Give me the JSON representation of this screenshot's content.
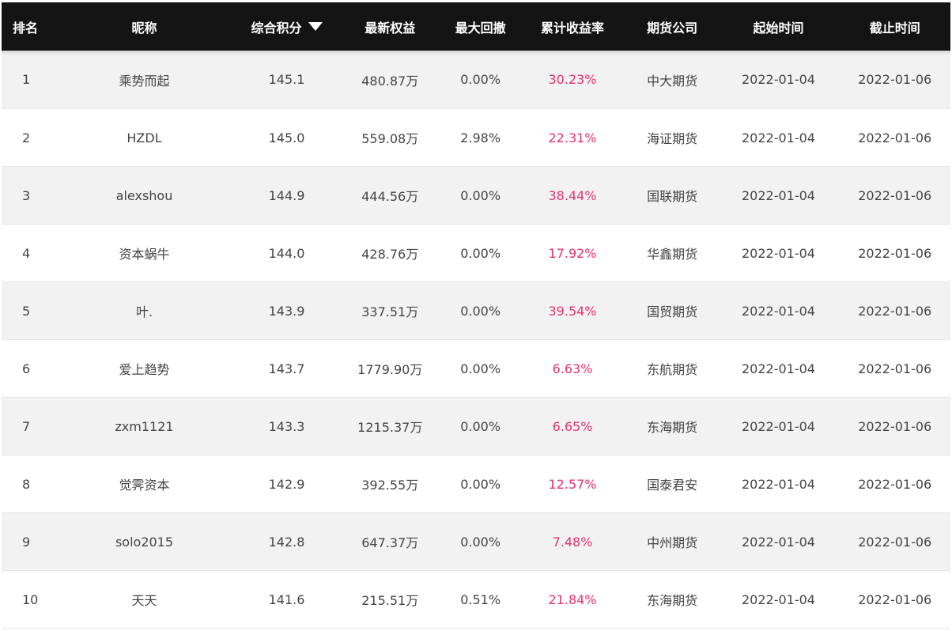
{
  "headers": {
    "rank": "排名",
    "nickname": "昵称",
    "score": "综合积分",
    "equity": "最新权益",
    "drawdown": "最大回撤",
    "return": "累计收益率",
    "company": "期货公司",
    "start": "起始时间",
    "end": "截止时间"
  },
  "sort_icon": "caret-down-icon",
  "colors": {
    "header_bg": "#141414",
    "return_text": "#e8316f",
    "stripe": "#f2f2f2"
  },
  "rows": [
    {
      "rank": "1",
      "nickname": "乘势而起",
      "score": "145.1",
      "equity": "480.87万",
      "drawdown": "0.00%",
      "return": "30.23%",
      "company": "中大期货",
      "start": "2022-01-04",
      "end": "2022-01-06"
    },
    {
      "rank": "2",
      "nickname": "HZDL",
      "score": "145.0",
      "equity": "559.08万",
      "drawdown": "2.98%",
      "return": "22.31%",
      "company": "海证期货",
      "start": "2022-01-04",
      "end": "2022-01-06"
    },
    {
      "rank": "3",
      "nickname": "alexshou",
      "score": "144.9",
      "equity": "444.56万",
      "drawdown": "0.00%",
      "return": "38.44%",
      "company": "国联期货",
      "start": "2022-01-04",
      "end": "2022-01-06"
    },
    {
      "rank": "4",
      "nickname": "资本蜗牛",
      "score": "144.0",
      "equity": "428.76万",
      "drawdown": "0.00%",
      "return": "17.92%",
      "company": "华鑫期货",
      "start": "2022-01-04",
      "end": "2022-01-06"
    },
    {
      "rank": "5",
      "nickname": "叶.",
      "score": "143.9",
      "equity": "337.51万",
      "drawdown": "0.00%",
      "return": "39.54%",
      "company": "国贸期货",
      "start": "2022-01-04",
      "end": "2022-01-06"
    },
    {
      "rank": "6",
      "nickname": "爱上趋势",
      "score": "143.7",
      "equity": "1779.90万",
      "drawdown": "0.00%",
      "return": "6.63%",
      "company": "东航期货",
      "start": "2022-01-04",
      "end": "2022-01-06"
    },
    {
      "rank": "7",
      "nickname": "zxm1121",
      "score": "143.3",
      "equity": "1215.37万",
      "drawdown": "0.00%",
      "return": "6.65%",
      "company": "东海期货",
      "start": "2022-01-04",
      "end": "2022-01-06"
    },
    {
      "rank": "8",
      "nickname": "觉霁资本",
      "score": "142.9",
      "equity": "392.55万",
      "drawdown": "0.00%",
      "return": "12.57%",
      "company": "国泰君安",
      "start": "2022-01-04",
      "end": "2022-01-06"
    },
    {
      "rank": "9",
      "nickname": "solo2015",
      "score": "142.8",
      "equity": "647.37万",
      "drawdown": "0.00%",
      "return": "7.48%",
      "company": "中州期货",
      "start": "2022-01-04",
      "end": "2022-01-06"
    },
    {
      "rank": "10",
      "nickname": "天天",
      "score": "141.6",
      "equity": "215.51万",
      "drawdown": "0.51%",
      "return": "21.84%",
      "company": "东海期货",
      "start": "2022-01-04",
      "end": "2022-01-06"
    }
  ]
}
